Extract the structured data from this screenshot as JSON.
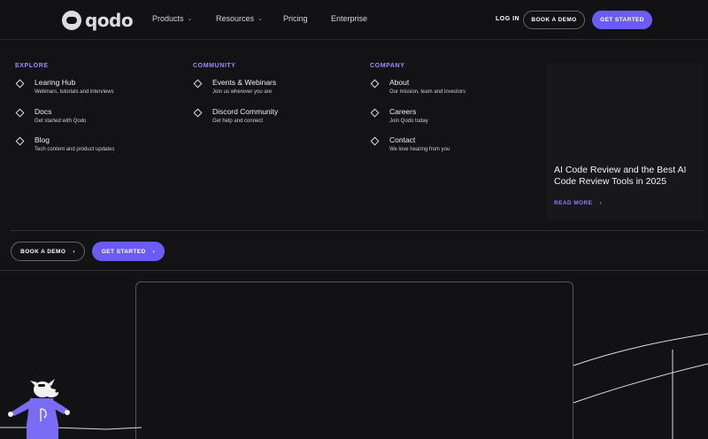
{
  "header": {
    "logo_text": "qodo",
    "nav": [
      {
        "label": "Products",
        "has_menu": true
      },
      {
        "label": "Resources",
        "has_menu": true
      },
      {
        "label": "Pricing",
        "has_menu": false
      },
      {
        "label": "Enterprise",
        "has_menu": false
      }
    ],
    "login_label": "LOG IN",
    "demo_label": "BOOK A DEMO",
    "start_label": "GET STARTED"
  },
  "menu": {
    "explore": {
      "heading": "EXPLORE",
      "items": [
        {
          "title": "Learing Hub",
          "desc": "Webinars, tutorials and interviews"
        },
        {
          "title": "Docs",
          "desc": "Get started with Qodo"
        },
        {
          "title": "Blog",
          "desc": "Tech content and product updates"
        }
      ]
    },
    "community": {
      "heading": "COMMUNITY",
      "items": [
        {
          "title": "Events & Webinars",
          "desc": "Join us wherever you are"
        },
        {
          "title": "Discord Community",
          "desc": "Get help and connect"
        }
      ]
    },
    "company": {
      "heading": "COMPANY",
      "items": [
        {
          "title": "About",
          "desc": "Our mission, team and investors"
        },
        {
          "title": "Careers",
          "desc": "Join Qodo today"
        },
        {
          "title": "Contact",
          "desc": "We love hearing from you"
        }
      ]
    },
    "feature": {
      "title": "AI Code Review and the Best AI Code Review Tools in 2025",
      "link_label": "READ MORE",
      "link_arrow": "›"
    },
    "footer": {
      "demo_label": "BOOK A DEMO",
      "start_label": "GET STARTED",
      "arrow": "›"
    }
  },
  "colors": {
    "accent": "#6b5cf6",
    "heading_accent": "#9d8cff",
    "background": "#121214"
  },
  "icons": {
    "chevron": "chevron-down-icon",
    "menu_item": "diamond-icon",
    "arrow": "arrow-right-icon"
  }
}
